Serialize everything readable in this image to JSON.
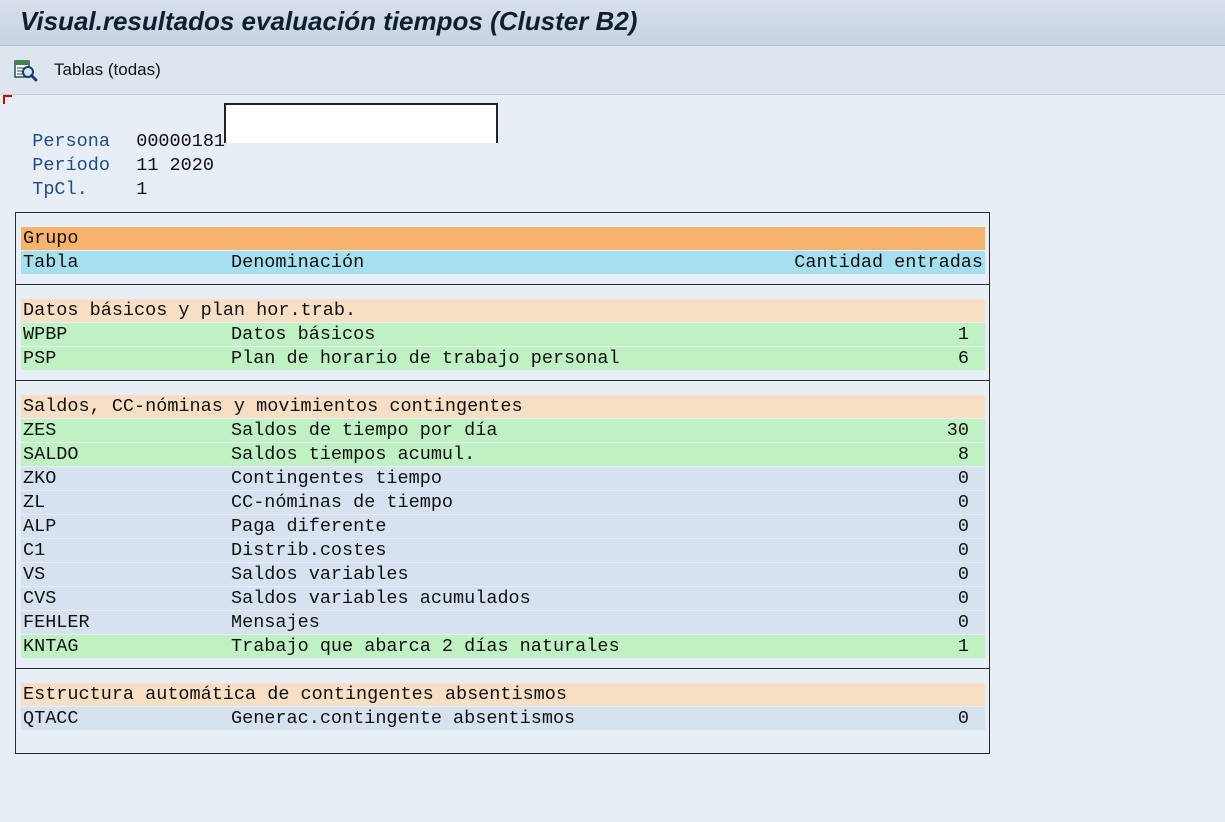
{
  "window": {
    "title": "Visual.resultados evaluación tiempos (Cluster B2)"
  },
  "toolbar": {
    "tables_all_label": "Tablas (todas)",
    "tables_icon": "table-search-icon"
  },
  "header": {
    "persona_label": "Persona",
    "persona_value": "00000181",
    "periodo_label": "Período",
    "periodo_value": "11 2020",
    "tpcl_label": "TpCl.",
    "tpcl_value": "1",
    "name_value": ""
  },
  "table": {
    "group_header": "Grupo",
    "columns": [
      "Tabla",
      "Denominación",
      "Cantidad entradas"
    ],
    "groups": [
      {
        "title": "Datos básicos y plan hor.trab.",
        "rows": [
          {
            "table": "WPBP",
            "description": "Datos básicos",
            "count": "1"
          },
          {
            "table": "PSP",
            "description": "Plan de horario de trabajo personal",
            "count": "6"
          }
        ]
      },
      {
        "title": "Saldos, CC-nóminas y movimientos contingentes",
        "rows": [
          {
            "table": "ZES",
            "description": "Saldos de tiempo por día",
            "count": "30"
          },
          {
            "table": "SALDO",
            "description": "Saldos tiempos acumul.",
            "count": "8"
          },
          {
            "table": "ZKO",
            "description": "Contingentes tiempo",
            "count": "0"
          },
          {
            "table": "ZL",
            "description": "CC-nóminas de tiempo",
            "count": "0"
          },
          {
            "table": "ALP",
            "description": "Paga diferente",
            "count": "0"
          },
          {
            "table": "C1",
            "description": "Distrib.costes",
            "count": "0"
          },
          {
            "table": "VS",
            "description": "Saldos variables",
            "count": "0"
          },
          {
            "table": "CVS",
            "description": "Saldos variables acumulados",
            "count": "0"
          },
          {
            "table": "FEHLER",
            "description": "Mensajes",
            "count": "0"
          },
          {
            "table": "KNTAG",
            "description": "Trabajo que abarca 2 días naturales",
            "count": "1"
          }
        ]
      },
      {
        "title": "Estructura automática de contingentes absentismos",
        "rows": [
          {
            "table": "QTACC",
            "description": "Generac.contingente absentismos",
            "count": "0"
          }
        ]
      }
    ]
  },
  "colors": {
    "group_header": "#f7b26d",
    "column_header": "#a6e0ee",
    "group_title": "#f6dfc4",
    "row_with_entries": "#bff1c3",
    "row_empty": "#d6e2ef",
    "label_blue": "#1d4c86"
  }
}
